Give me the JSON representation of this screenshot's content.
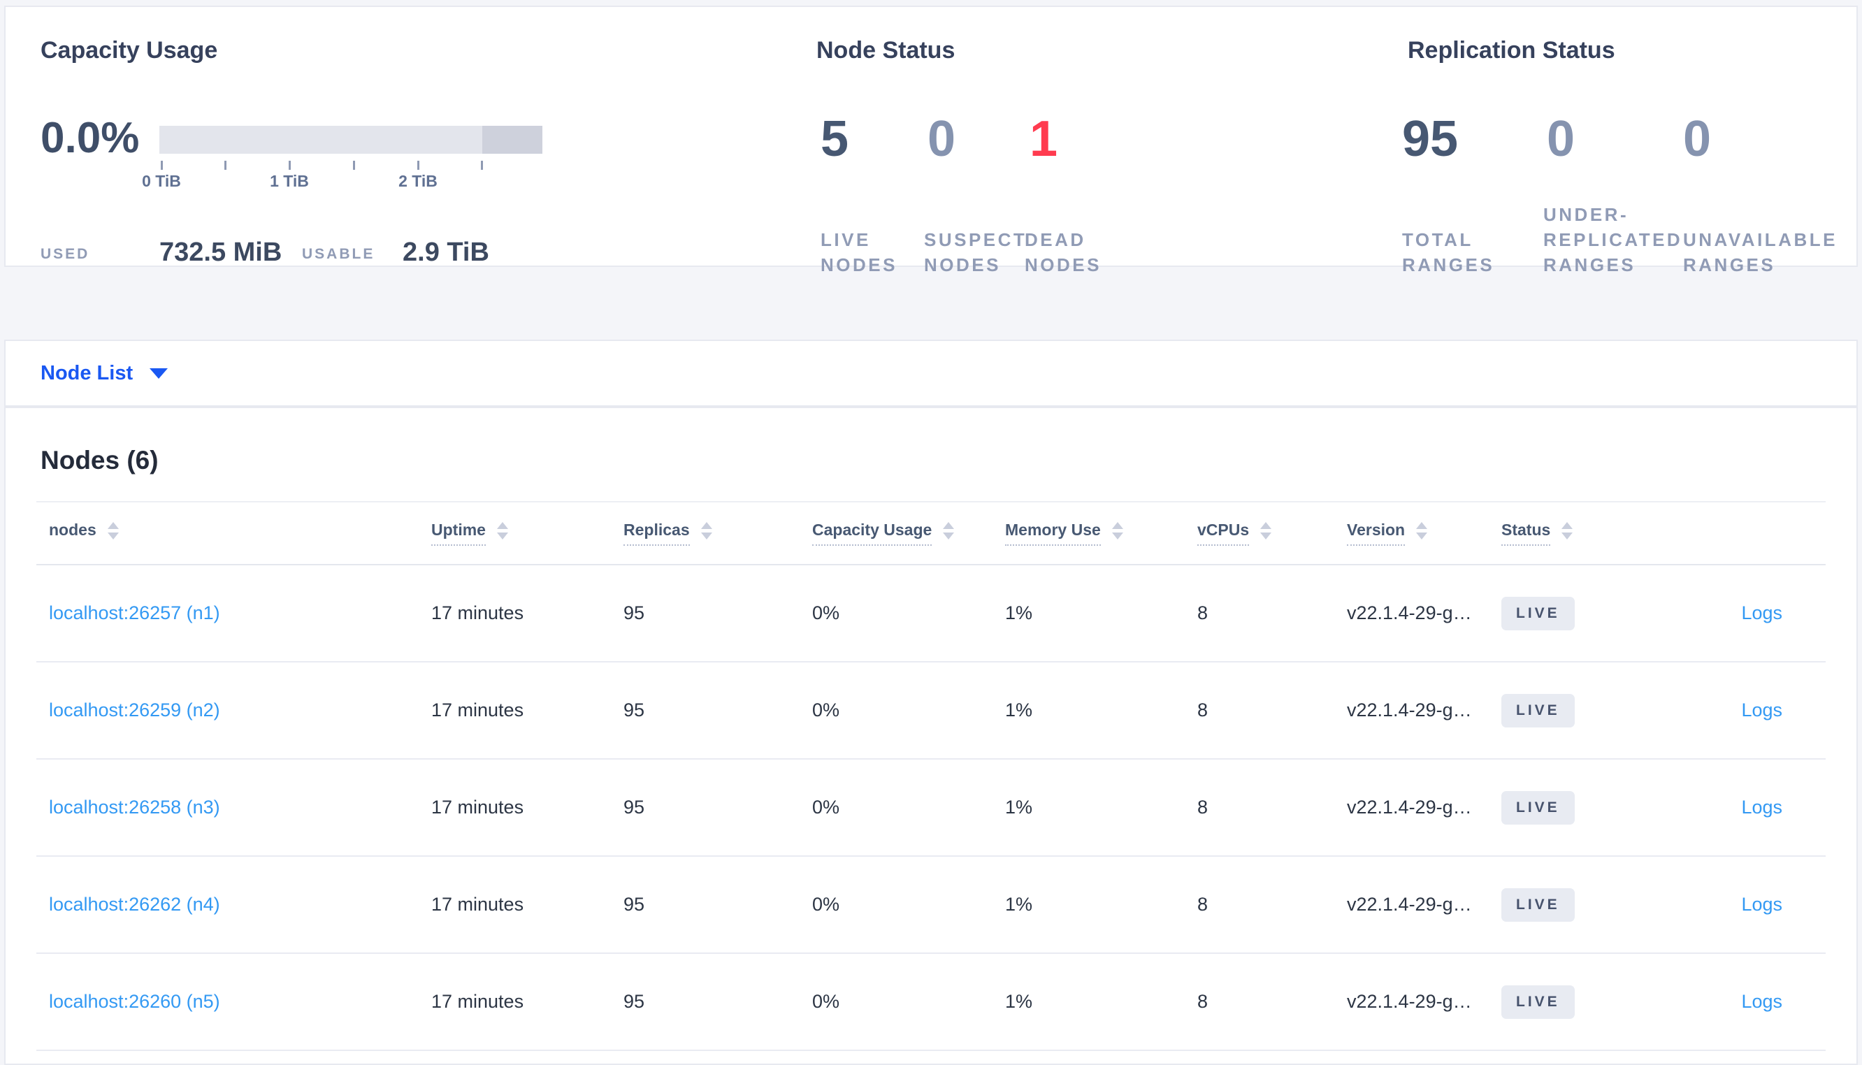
{
  "summary": {
    "capacity": {
      "title": "Capacity Usage",
      "percent": "0.0%",
      "tick_labels": [
        "0 TiB",
        "1 TiB",
        "2 TiB"
      ],
      "used_label": "USED",
      "used_value": "732.5 MiB",
      "usable_label": "USABLE",
      "usable_value": "2.9 TiB"
    },
    "node_status": {
      "title": "Node Status",
      "stats": [
        {
          "value": "5",
          "line1": "LIVE",
          "line2": "NODES"
        },
        {
          "value": "0",
          "line1": "SUSPECT",
          "line2": "NODES"
        },
        {
          "value": "1",
          "line1": "DEAD",
          "line2": "NODES"
        }
      ]
    },
    "replication": {
      "title": "Replication Status",
      "stats": [
        {
          "value": "95",
          "line1": "TOTAL",
          "line2": "RANGES"
        },
        {
          "value": "0",
          "line0": "UNDER-",
          "line1": "REPLICATED",
          "line2": "RANGES"
        },
        {
          "value": "0",
          "line1": "UNAVAILABLE",
          "line2": "RANGES"
        }
      ]
    }
  },
  "node_list_bar": {
    "label": "Node List"
  },
  "nodes": {
    "heading": "Nodes (6)",
    "columns": {
      "nodes": "nodes",
      "uptime": "Uptime",
      "replicas": "Replicas",
      "capacity": "Capacity Usage",
      "memory": "Memory Use",
      "vcpus": "vCPUs",
      "version": "Version",
      "status": "Status"
    },
    "logs_label": "Logs",
    "rows": [
      {
        "address": "localhost:26257 (n1)",
        "uptime": "17 minutes",
        "replicas": "95",
        "capacity": "0%",
        "memory": "1%",
        "vcpus": "8",
        "version": "v22.1.4-29-g…",
        "status": "LIVE",
        "logs": "Logs"
      },
      {
        "address": "localhost:26259 (n2)",
        "uptime": "17 minutes",
        "replicas": "95",
        "capacity": "0%",
        "memory": "1%",
        "vcpus": "8",
        "version": "v22.1.4-29-g…",
        "status": "LIVE",
        "logs": "Logs"
      },
      {
        "address": "localhost:26258 (n3)",
        "uptime": "17 minutes",
        "replicas": "95",
        "capacity": "0%",
        "memory": "1%",
        "vcpus": "8",
        "version": "v22.1.4-29-g…",
        "status": "LIVE",
        "logs": "Logs"
      },
      {
        "address": "localhost:26262 (n4)",
        "uptime": "17 minutes",
        "replicas": "95",
        "capacity": "0%",
        "memory": "1%",
        "vcpus": "8",
        "version": "v22.1.4-29-g…",
        "status": "LIVE",
        "logs": "Logs"
      },
      {
        "address": "localhost:26260 (n5)",
        "uptime": "17 minutes",
        "replicas": "95",
        "capacity": "0%",
        "memory": "1%",
        "vcpus": "8",
        "version": "v22.1.4-29-g…",
        "status": "LIVE",
        "logs": "Logs"
      }
    ]
  },
  "colors": {
    "accent_blue": "#1a58f2",
    "link_blue": "#3399f3",
    "danger_red": "#ff3b4f",
    "dark_slate": "#475872",
    "muted_slate": "#8593af"
  }
}
